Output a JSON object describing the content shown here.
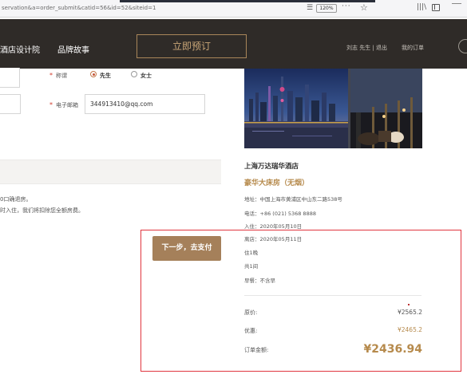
{
  "browser": {
    "url": "servation&a=order_submit&catid=56&id=52&siteid=1",
    "zoom": "120%",
    "more": "···"
  },
  "nav": {
    "item_1": "酒店设计院",
    "item_2": "品牌故事",
    "reserve_button": "立即预订",
    "user": "刘志 先生 | 退出",
    "orders": "我的订单"
  },
  "form": {
    "title_label": "称谓",
    "option_mr": "先生",
    "option_ms": "女士",
    "selected": "先生",
    "email_label": "电子邮箱",
    "email_value": "344913410@qq.com",
    "policy_line_1": "0口确退房。",
    "policy_line_2": "时入住，我们将扣除您全额房费。",
    "next_button": "下一步，去支付"
  },
  "order": {
    "hotel_name": "上海万达瑞华酒店",
    "room_name": "豪华大床房（无烟）",
    "address": "地址：中国上海市黄浦区中山东二路538号",
    "phone": "电话：+86 (021) 5368 8888",
    "check_in": "入住：2020年05月10日",
    "check_out": "离店：2020年05月11日",
    "nights": "住1晚",
    "rooms": "共1间",
    "breakfast": "早餐：不含早",
    "original_price_label": "原价:",
    "original_price": "¥2565.2",
    "discount_label": "优惠:",
    "discount_price": "¥2465.2",
    "total_label": "订单金额:",
    "total": "¥2436.94"
  },
  "colors": {
    "nav_bg": "#2f2b28",
    "accent": "#b68a4c",
    "button_bg": "#a5805a",
    "highlight_frame": "#e0353f"
  }
}
